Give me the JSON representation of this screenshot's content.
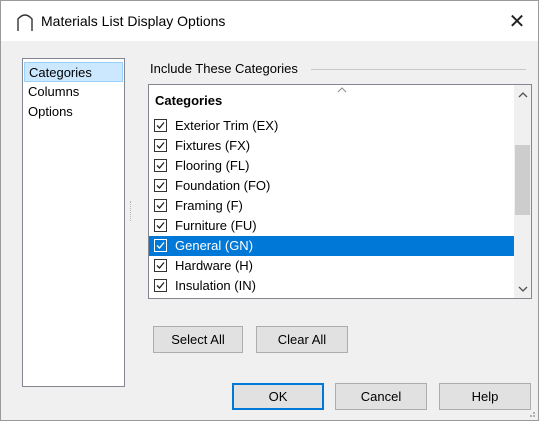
{
  "window": {
    "title": "Materials List Display Options",
    "close_glyph": "✕"
  },
  "nav": {
    "items": [
      {
        "label": "Categories",
        "selected": true
      },
      {
        "label": "Columns",
        "selected": false
      },
      {
        "label": "Options",
        "selected": false
      }
    ]
  },
  "group": {
    "label": "Include These Categories"
  },
  "list": {
    "header": "Categories",
    "rows": [
      {
        "label": "Exterior Trim (EX)",
        "checked": true,
        "selected": false
      },
      {
        "label": "Fixtures (FX)",
        "checked": true,
        "selected": false
      },
      {
        "label": "Flooring (FL)",
        "checked": true,
        "selected": false
      },
      {
        "label": "Foundation (FO)",
        "checked": true,
        "selected": false
      },
      {
        "label": "Framing (F)",
        "checked": true,
        "selected": false
      },
      {
        "label": "Furniture (FU)",
        "checked": true,
        "selected": false
      },
      {
        "label": "General (GN)",
        "checked": true,
        "selected": true
      },
      {
        "label": "Hardware (H)",
        "checked": true,
        "selected": false
      },
      {
        "label": "Insulation (IN)",
        "checked": true,
        "selected": false
      }
    ]
  },
  "buttons": {
    "select_all": "Select All",
    "clear_all": "Clear All",
    "ok": "OK",
    "cancel": "Cancel",
    "help": "Help"
  },
  "icons": {
    "app": "arch-roof-icon",
    "close": "close-icon",
    "checkbox": "checkmark-icon",
    "scroll_up": "chevron-up-icon",
    "scroll_down": "chevron-down-icon"
  },
  "colors": {
    "selection": "#0078d7",
    "nav_selection": "#cce8ff",
    "default_button_border": "#0078d7"
  }
}
